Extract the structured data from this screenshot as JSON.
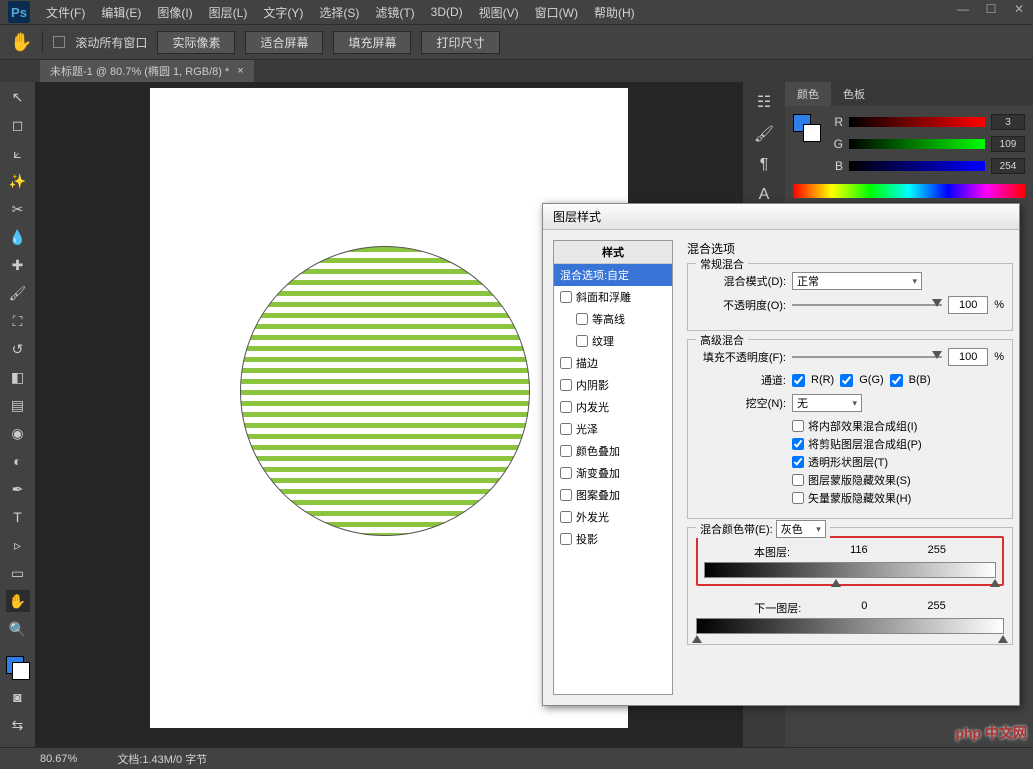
{
  "menu": {
    "items": [
      "文件(F)",
      "编辑(E)",
      "图像(I)",
      "图层(L)",
      "文字(Y)",
      "选择(S)",
      "滤镜(T)",
      "3D(D)",
      "视图(V)",
      "窗口(W)",
      "帮助(H)"
    ]
  },
  "options": {
    "scroll_all": "滚动所有窗口",
    "actual_pixels": "实际像素",
    "fit_screen": "适合屏幕",
    "fill_screen": "填充屏幕",
    "print_size": "打印尺寸"
  },
  "tab": {
    "label": "未标题-1 @ 80.7% (椭圆 1, RGB/8) *"
  },
  "status": {
    "zoom": "80.67%",
    "info": "文档:1.43M/0 字节"
  },
  "color_panel": {
    "tab1": "颜色",
    "tab2": "色板",
    "r": "R",
    "r_val": "3",
    "g": "G",
    "g_val": "109",
    "b": "B",
    "b_val": "254"
  },
  "dialog": {
    "title": "图层样式",
    "styles_header": "样式",
    "blend_custom": "混合选项:自定",
    "bevel": "斜面和浮雕",
    "contour": "等高线",
    "texture": "纹理",
    "stroke": "描边",
    "inner_shadow": "内阴影",
    "inner_glow": "内发光",
    "satin": "光泽",
    "color_overlay": "颜色叠加",
    "gradient_overlay": "渐变叠加",
    "pattern_overlay": "图案叠加",
    "outer_glow": "外发光",
    "drop_shadow": "投影",
    "blend_options_title": "混合选项",
    "general_blend": "常规混合",
    "blend_mode_lbl": "混合模式(D):",
    "blend_mode_val": "正常",
    "opacity_lbl": "不透明度(O):",
    "opacity_val": "100",
    "percent": "%",
    "advanced_blend": "高级混合",
    "fill_opacity_lbl": "填充不透明度(F):",
    "fill_opacity_val": "100",
    "channels_lbl": "通道:",
    "ch_r": "R(R)",
    "ch_g": "G(G)",
    "ch_b": "B(B)",
    "knockout_lbl": "挖空(N):",
    "knockout_val": "无",
    "adv1": "将内部效果混合成组(I)",
    "adv2": "将剪贴图层混合成组(P)",
    "adv3": "透明形状图层(T)",
    "adv4": "图层蒙版隐藏效果(S)",
    "adv5": "矢量蒙版隐藏效果(H)",
    "blend_if_lbl": "混合颜色带(E):",
    "blend_if_val": "灰色",
    "this_layer": "本图层:",
    "this_low": "116",
    "this_high": "255",
    "under_layer": "下一图层:",
    "under_low": "0",
    "under_high": "255"
  },
  "watermark": "php 中文网"
}
